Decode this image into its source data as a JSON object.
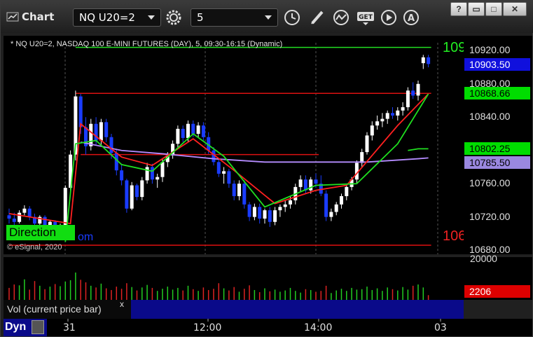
{
  "window": {
    "title": "Chart",
    "symbol_value": "NQ U20=2",
    "interval_value": "5",
    "buttons": [
      "?",
      "▭",
      "□",
      "✕"
    ],
    "icons": [
      "chart-app-icon",
      "gear-icon",
      "clock-icon",
      "pencil-icon",
      "study-icon",
      "get-icon",
      "play-icon",
      "alert-icon"
    ]
  },
  "chart": {
    "caption": "* NQ U20=2, NASDAQ 100 E-MINI FUTURES (DAY), 5, 09:30-16:15 (Dynamic)",
    "copyright": "© eSignal, 2020",
    "direction_label": "Direction",
    "direction_suffix": "om",
    "top_edge_label": "109",
    "bottom_edge_label": "106",
    "colors": {
      "background": "#000000",
      "up_candle": "#ffffff",
      "down_candle": "#1a3cff",
      "fast_ma": "#ff2020",
      "slow_ma": "#20e020",
      "vwap_line": "#b58cff",
      "level_line": "#dd1111",
      "top_line": "#22dd22"
    }
  },
  "price_axis": {
    "ticks": [
      "10920.00",
      "10880.00",
      "10840.00",
      "10800.00",
      "10760.00",
      "10720.00",
      "10680.00"
    ],
    "badges": [
      {
        "label": "10903.50",
        "bg": "#1010dd",
        "fg": "#ffffff"
      },
      {
        "label": "10868.66",
        "bg": "#00dd00",
        "fg": "#000000"
      },
      {
        "label": "10802.25",
        "bg": "#00dd00",
        "fg": "#000000"
      },
      {
        "label": "10785.50",
        "bg": "#9a88e0",
        "fg": "#000000"
      }
    ]
  },
  "volume": {
    "axis_label": "20000",
    "last_value": "2206",
    "legend_label": "Vol (current price bar)",
    "close_label": "x"
  },
  "time_axis": {
    "corner_label": "Dyn",
    "ticks": [
      "31",
      "12:00",
      "14:00",
      "03"
    ]
  },
  "chart_data": {
    "type": "candlestick",
    "ylim": [
      10675,
      10938
    ],
    "x_labels": [
      "31",
      "12:00",
      "14:00",
      "03"
    ],
    "candles": [
      [
        10722,
        10730,
        10712,
        10718
      ],
      [
        10718,
        10725,
        10710,
        10714
      ],
      [
        10714,
        10728,
        10712,
        10725
      ],
      [
        10725,
        10734,
        10722,
        10730
      ],
      [
        10730,
        10733,
        10716,
        10720
      ],
      [
        10720,
        10724,
        10708,
        10712
      ],
      [
        10712,
        10722,
        10708,
        10720
      ],
      [
        10720,
        10722,
        10704,
        10708
      ],
      [
        10708,
        10716,
        10700,
        10714
      ],
      [
        10714,
        10716,
        10702,
        10706
      ],
      [
        10706,
        10712,
        10700,
        10710
      ],
      [
        10710,
        10758,
        10704,
        10755
      ],
      [
        10755,
        10800,
        10750,
        10795
      ],
      [
        10795,
        10872,
        10788,
        10865
      ],
      [
        10865,
        10868,
        10820,
        10828
      ],
      [
        10828,
        10840,
        10795,
        10805
      ],
      [
        10805,
        10838,
        10800,
        10832
      ],
      [
        10832,
        10840,
        10806,
        10812
      ],
      [
        10812,
        10838,
        10806,
        10834
      ],
      [
        10834,
        10838,
        10810,
        10816
      ],
      [
        10816,
        10820,
        10790,
        10797
      ],
      [
        10797,
        10802,
        10770,
        10776
      ],
      [
        10776,
        10784,
        10758,
        10764
      ],
      [
        10764,
        10766,
        10725,
        10730
      ],
      [
        10730,
        10762,
        10728,
        10758
      ],
      [
        10758,
        10760,
        10740,
        10744
      ],
      [
        10744,
        10768,
        10740,
        10764
      ],
      [
        10764,
        10785,
        10760,
        10780
      ],
      [
        10780,
        10784,
        10760,
        10765
      ],
      [
        10765,
        10772,
        10755,
        10768
      ],
      [
        10768,
        10790,
        10762,
        10786
      ],
      [
        10786,
        10798,
        10780,
        10794
      ],
      [
        10794,
        10812,
        10790,
        10808
      ],
      [
        10808,
        10830,
        10804,
        10826
      ],
      [
        10826,
        10830,
        10810,
        10815
      ],
      [
        10815,
        10836,
        10810,
        10832
      ],
      [
        10832,
        10836,
        10816,
        10820
      ],
      [
        10820,
        10834,
        10815,
        10830
      ],
      [
        10830,
        10834,
        10812,
        10816
      ],
      [
        10816,
        10822,
        10796,
        10800
      ],
      [
        10800,
        10804,
        10782,
        10786
      ],
      [
        10786,
        10790,
        10768,
        10772
      ],
      [
        10772,
        10780,
        10760,
        10775
      ],
      [
        10775,
        10778,
        10755,
        10760
      ],
      [
        10760,
        10764,
        10740,
        10745
      ],
      [
        10745,
        10764,
        10740,
        10760
      ],
      [
        10760,
        10764,
        10730,
        10735
      ],
      [
        10735,
        10738,
        10715,
        10720
      ],
      [
        10720,
        10736,
        10716,
        10732
      ],
      [
        10732,
        10736,
        10712,
        10718
      ],
      [
        10718,
        10730,
        10712,
        10728
      ],
      [
        10728,
        10732,
        10708,
        10714
      ],
      [
        10714,
        10732,
        10710,
        10728
      ],
      [
        10728,
        10735,
        10720,
        10732
      ],
      [
        10732,
        10740,
        10726,
        10735
      ],
      [
        10735,
        10745,
        10730,
        10740
      ],
      [
        10740,
        10760,
        10735,
        10756
      ],
      [
        10756,
        10770,
        10750,
        10765
      ],
      [
        10765,
        10770,
        10748,
        10752
      ],
      [
        10752,
        10768,
        10748,
        10765
      ],
      [
        10765,
        10772,
        10755,
        10760
      ],
      [
        10760,
        10770,
        10745,
        10748
      ],
      [
        10748,
        10752,
        10715,
        10720
      ],
      [
        10720,
        10730,
        10715,
        10726
      ],
      [
        10726,
        10738,
        10722,
        10735
      ],
      [
        10735,
        10748,
        10730,
        10745
      ],
      [
        10745,
        10758,
        10740,
        10756
      ],
      [
        10756,
        10768,
        10752,
        10765
      ],
      [
        10765,
        10788,
        10760,
        10785
      ],
      [
        10785,
        10802,
        10780,
        10798
      ],
      [
        10798,
        10822,
        10795,
        10818
      ],
      [
        10818,
        10835,
        10812,
        10830
      ],
      [
        10830,
        10842,
        10825,
        10835
      ],
      [
        10835,
        10845,
        10828,
        10838
      ],
      [
        10838,
        10848,
        10832,
        10845
      ],
      [
        10845,
        10852,
        10838,
        10842
      ],
      [
        10842,
        10852,
        10836,
        10848
      ],
      [
        10848,
        10858,
        10842,
        10852
      ],
      [
        10852,
        10876,
        10848,
        10872
      ],
      [
        10872,
        10882,
        10862,
        10866
      ],
      [
        10866,
        10884,
        10860,
        10880
      ],
      [
        10905,
        10915,
        10898,
        10912
      ],
      [
        10912,
        10915,
        10900,
        10904
      ]
    ],
    "fast_ma": [
      [
        0,
        10724
      ],
      [
        12,
        10712
      ],
      [
        14,
        10832
      ],
      [
        22,
        10792
      ],
      [
        28,
        10782
      ],
      [
        36,
        10814
      ],
      [
        44,
        10776
      ],
      [
        52,
        10736
      ],
      [
        60,
        10752
      ],
      [
        66,
        10758
      ],
      [
        76,
        10830
      ],
      [
        82,
        10868
      ]
    ],
    "slow_ma": [
      [
        11,
        10690
      ],
      [
        13,
        10808
      ],
      [
        17,
        10812
      ],
      [
        22,
        10783
      ],
      [
        28,
        10775
      ],
      [
        36,
        10820
      ],
      [
        42,
        10793
      ],
      [
        50,
        10732
      ],
      [
        60,
        10758
      ],
      [
        68,
        10760
      ],
      [
        76,
        10808
      ],
      [
        82,
        10868
      ]
    ],
    "vwap": [
      [
        14,
        10810
      ],
      [
        22,
        10800
      ],
      [
        30,
        10796
      ],
      [
        40,
        10790
      ],
      [
        50,
        10786
      ],
      [
        60,
        10786
      ],
      [
        70,
        10786
      ],
      [
        80,
        10790
      ],
      [
        82,
        10791
      ]
    ],
    "levels": [
      {
        "value": 10868.66,
        "from": 13,
        "to": 82
      },
      {
        "value": 10795,
        "from": 14,
        "to": 60
      },
      {
        "value": 10686,
        "from": 0,
        "to": 82
      }
    ],
    "green_tail": [
      [
        78,
        10800
      ],
      [
        80,
        10802
      ],
      [
        82,
        10802
      ]
    ],
    "top_green": [
      [
        13,
        10924
      ],
      [
        82,
        10924
      ]
    ],
    "volume": [
      5600,
      7200,
      6800,
      9600,
      4800,
      8800,
      6600,
      5000,
      6200,
      7400,
      6400,
      8600,
      9200,
      12800,
      9400,
      8200,
      6600,
      5800,
      7600,
      5400,
      4600,
      6200,
      5200,
      7800,
      6000,
      4400,
      5800,
      7000,
      5600,
      4200,
      5200,
      6200,
      4800,
      5600,
      4400,
      6600,
      5000,
      4200,
      5800,
      4600,
      5200,
      7800,
      5400,
      4400,
      6000,
      3800,
      5200,
      6800,
      4600,
      3600,
      5400,
      4000,
      4800,
      3800,
      4400,
      5600,
      4200,
      3400,
      5000,
      4600,
      3800,
      4200,
      6600,
      3200,
      4400,
      5200,
      4200,
      5600,
      4800,
      5000,
      6200,
      4600,
      5400,
      4200,
      5800,
      5000,
      4400,
      6000,
      4800,
      6600,
      7200,
      5800,
      2206
    ]
  }
}
